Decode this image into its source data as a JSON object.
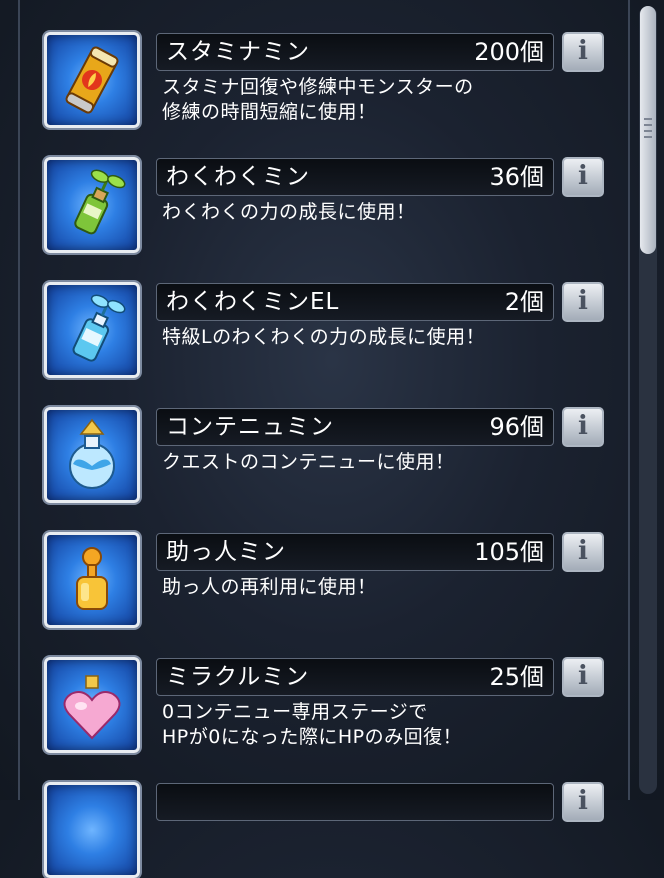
{
  "items": [
    {
      "name": "スタミナミン",
      "count": "200個",
      "desc": [
        "スタミナ回復や修練中モンスターの",
        "修練の時間短縮に使用！"
      ],
      "icon": "stamina-can-icon"
    },
    {
      "name": "わくわくミン",
      "count": "36個",
      "desc": [
        "わくわくの力の成長に使用！"
      ],
      "icon": "sprout-bottle-icon"
    },
    {
      "name": "わくわくミンEL",
      "count": "2個",
      "desc": [
        "特級Lのわくわくの力の成長に使用！"
      ],
      "icon": "el-bottle-icon"
    },
    {
      "name": "コンテニュミン",
      "count": "96個",
      "desc": [
        "クエストのコンテニューに使用！"
      ],
      "icon": "winged-flask-icon"
    },
    {
      "name": "助っ人ミン",
      "count": "105個",
      "desc": [
        "助っ人の再利用に使用！"
      ],
      "icon": "person-vial-icon"
    },
    {
      "name": "ミラクルミン",
      "count": "25個",
      "desc": [
        "0コンテニュー専用ステージで",
        "HPが0になった際にHPのみ回復！"
      ],
      "icon": "heart-potion-icon"
    }
  ],
  "info_label": "i",
  "colors": {
    "panel_bg": "#1b2230",
    "icon_blue": "#2e7fe4",
    "text": "#ffffff"
  }
}
